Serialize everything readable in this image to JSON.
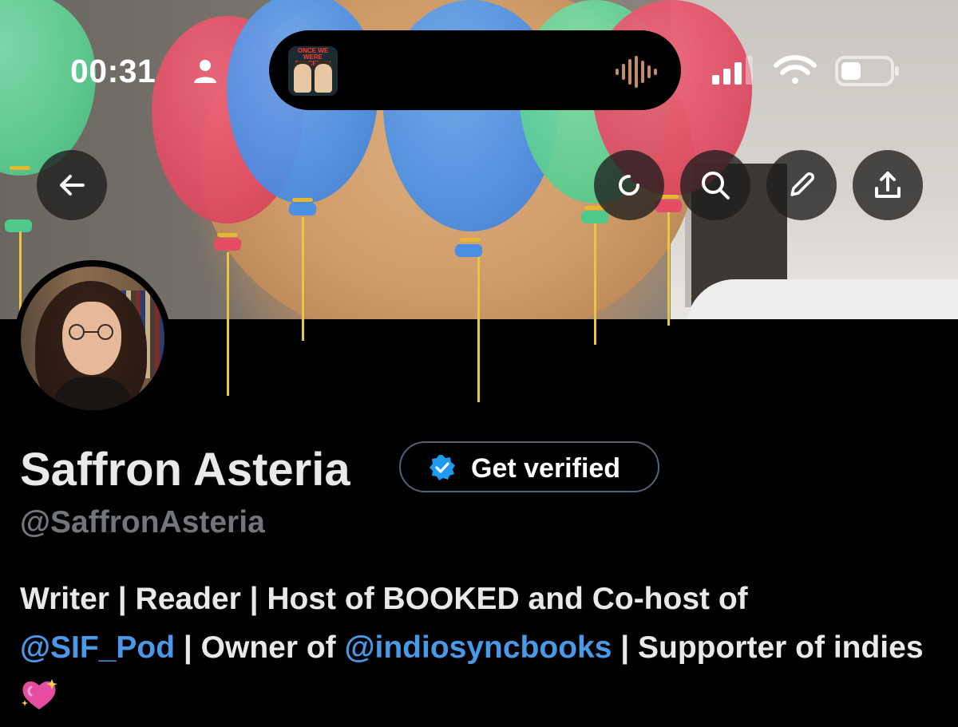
{
  "status_bar": {
    "time": "00:31",
    "person_icon": "person-icon",
    "now_playing_art_text": "ONCE WE WERE SPACEMEN",
    "waveform_icon": "waveform-icon",
    "signal_icon": "cellular-signal-icon",
    "wifi_icon": "wifi-icon",
    "battery_icon": "battery-icon"
  },
  "header_buttons": [
    {
      "name": "back",
      "icon": "arrow-left-icon"
    },
    {
      "name": "refresh",
      "icon": "refresh-icon"
    },
    {
      "name": "search",
      "icon": "search-icon"
    },
    {
      "name": "edit",
      "icon": "pencil-icon"
    },
    {
      "name": "share",
      "icon": "share-icon"
    }
  ],
  "profile": {
    "name": "Saffron Asteria",
    "handle": "@SaffronAsteria",
    "verify_button_label": "Get verified",
    "verify_icon": "verified-badge-icon",
    "bio": {
      "text_1": "Writer | Reader | Host of BOOKED and Co-host of",
      "link_1": "@SIF_Pod",
      "text_2": " | Owner of ",
      "link_2": "@indiosyncbooks",
      "text_3": " | Supporter of indies ",
      "emoji": "sparkling-heart-emoji"
    }
  },
  "colors": {
    "background": "#000000",
    "link": "#4a99e9",
    "handle": "#71767b",
    "button_border": "#536471",
    "verified_blue": "#1d9bf0",
    "balloon_green": "#5ccf92",
    "balloon_red": "#e04b62",
    "balloon_blue": "#4a8fe6"
  }
}
